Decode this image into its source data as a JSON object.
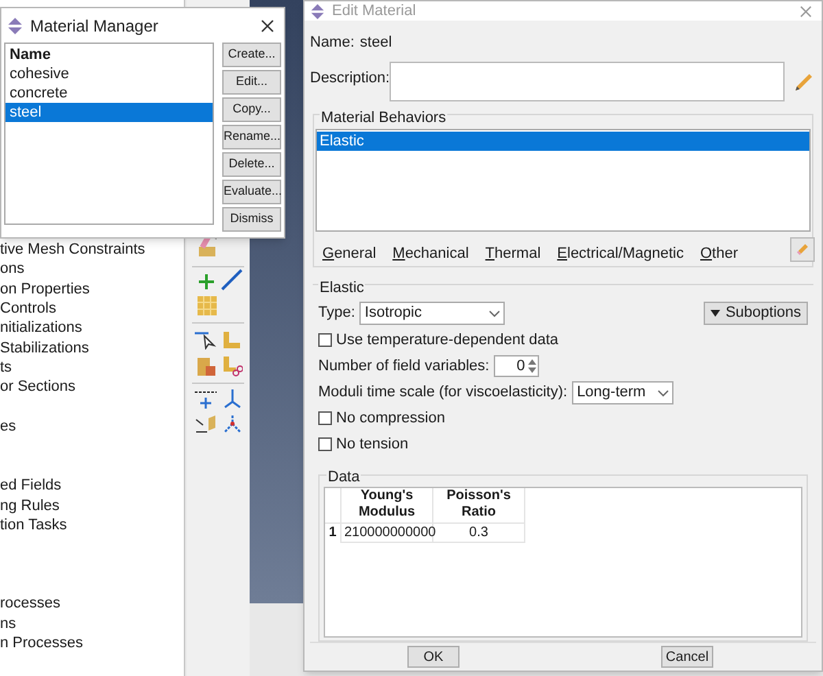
{
  "model_tree": {
    "items": [
      "tive Mesh Constraints",
      "ons",
      "on Properties",
      "Controls",
      "nitializations",
      "Stabilizations",
      "ts",
      "or Sections",
      "es",
      "ed Fields",
      "ng Rules",
      "tion Tasks",
      "rocesses",
      "ns",
      "n Processes"
    ]
  },
  "material_manager": {
    "title": "Material Manager",
    "active": true,
    "list_header": "Name",
    "materials": [
      {
        "name": "cohesive",
        "selected": false
      },
      {
        "name": "concrete",
        "selected": false
      },
      {
        "name": "steel",
        "selected": true
      }
    ],
    "buttons": [
      "Create...",
      "Edit...",
      "Copy...",
      "Rename...",
      "Delete...",
      "Evaluate...",
      "Dismiss"
    ]
  },
  "edit_material": {
    "title": "Edit Material",
    "active": false,
    "name_label": "Name:",
    "name_value": "steel",
    "description_label": "Description:",
    "behaviors_label": "Material Behaviors",
    "behaviors": [
      {
        "name": "Elastic",
        "selected": true
      }
    ],
    "menus": [
      {
        "label": "General",
        "accelerator": true
      },
      {
        "label": "Mechanical",
        "accelerator": true
      },
      {
        "label": "Thermal",
        "accelerator": true
      },
      {
        "label": "Electrical/Magnetic",
        "accelerator": true
      },
      {
        "label": "Other",
        "accelerator": true
      }
    ],
    "section_title": "Elastic",
    "type_label": "Type:",
    "type_value": "Isotropic",
    "suboptions_button": "Suboptions",
    "options": [
      {
        "kind": "checkbox",
        "label": "Use temperature-dependent data",
        "checked": false
      },
      {
        "kind": "spinner",
        "label": "Number of field variables:",
        "value": "0"
      },
      {
        "kind": "dropdown",
        "label": "Moduli time scale (for viscoelasticity):",
        "value": "Long-term"
      },
      {
        "kind": "checkbox",
        "label": "No compression",
        "checked": false
      },
      {
        "kind": "checkbox",
        "label": "No tension",
        "checked": false
      }
    ],
    "data": {
      "label": "Data",
      "columns": [
        "Young's Modulus",
        "Poisson's Ratio"
      ],
      "rows": [
        {
          "index": "1",
          "cells": [
            "210000000000",
            "0.3"
          ]
        }
      ]
    },
    "buttons": [
      "OK",
      "Cancel"
    ]
  }
}
